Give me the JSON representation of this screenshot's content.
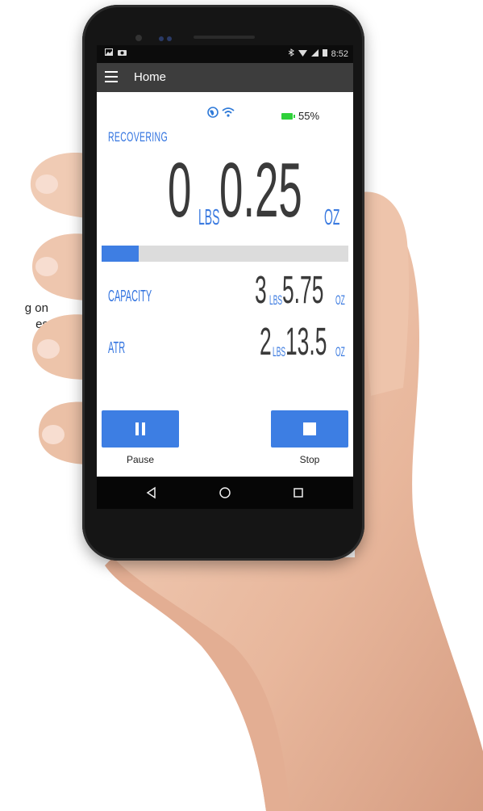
{
  "background_text": [
    "g on",
    "es"
  ],
  "status_bar": {
    "time": "8:52",
    "left_icons": [
      "image-icon",
      "camera-icon"
    ],
    "right_icons": [
      "bluetooth-icon",
      "wifi-icon",
      "signal-icon",
      "battery-icon"
    ]
  },
  "app_bar": {
    "title": "Home",
    "menu_icon": "hamburger-menu-icon"
  },
  "device": {
    "connection_icons": [
      "globe-icon",
      "wifi-icon"
    ],
    "battery_percent": "55%",
    "battery_color": "#2fd13a"
  },
  "reading": {
    "state": "RECOVERING",
    "lbs_value": "0",
    "lbs_unit": "LBS",
    "oz_value": "0.25",
    "oz_unit": "OZ"
  },
  "progress": {
    "fraction": 0.15,
    "color": "#3e7ee3"
  },
  "stats": [
    {
      "label": "CAPACITY",
      "lbs_value": "3",
      "lbs_unit": "LBS",
      "oz_value": "5.75",
      "oz_unit": "OZ"
    },
    {
      "label": "ATR",
      "lbs_value": "2",
      "lbs_unit": "LBS",
      "oz_value": "13.5",
      "oz_unit": "OZ"
    }
  ],
  "controls": {
    "pause_label": "Pause",
    "stop_label": "Stop",
    "button_color": "#3d7ee3"
  },
  "nav": [
    "back-icon",
    "home-icon",
    "recents-icon"
  ],
  "accent_color": "#3475e0"
}
